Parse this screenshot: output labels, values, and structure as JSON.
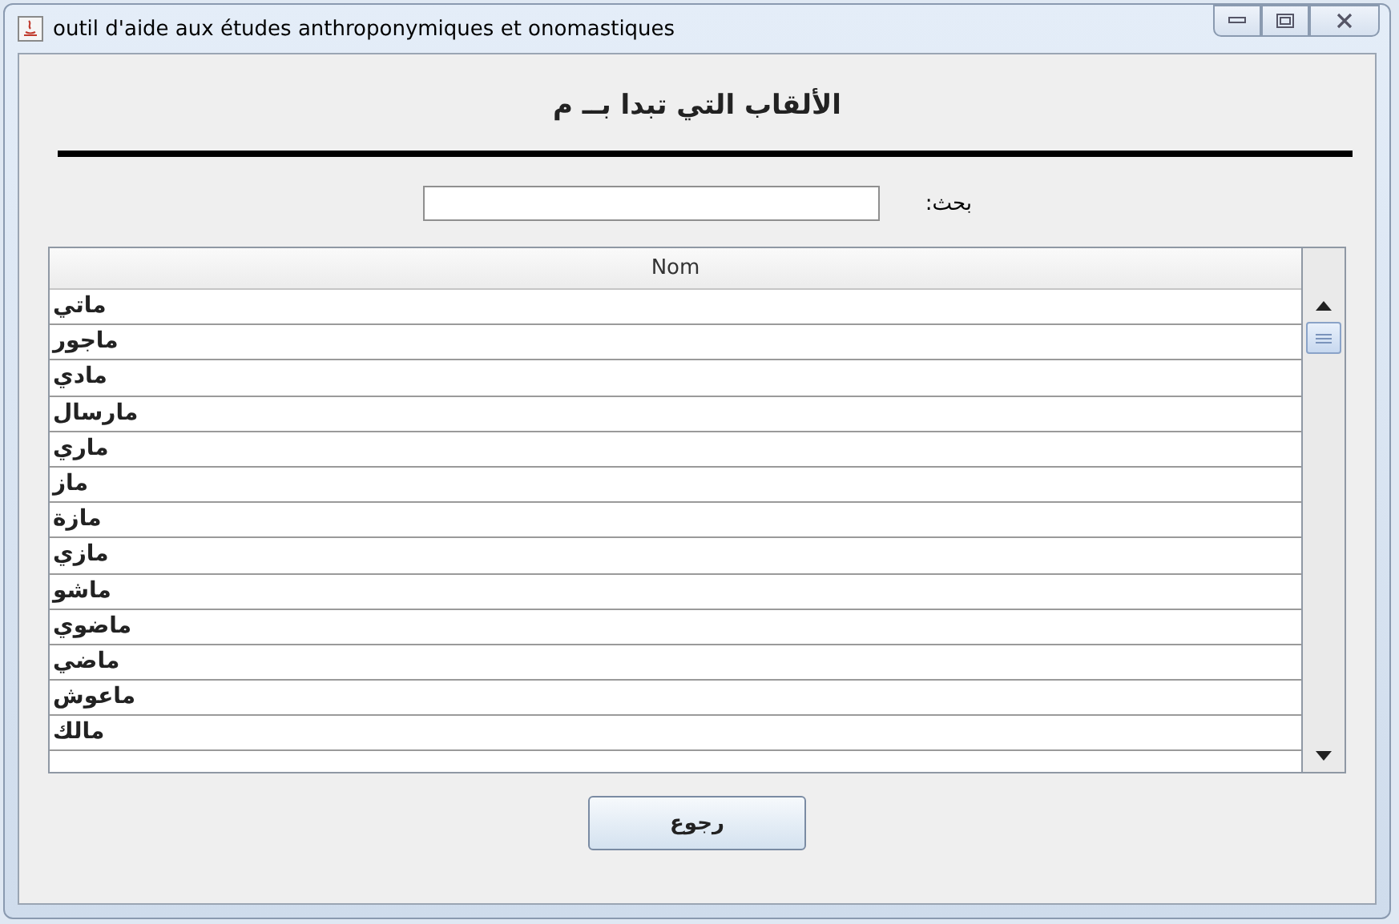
{
  "window": {
    "title": "outil d'aide aux études anthroponymiques et onomastiques"
  },
  "heading": "الألقاب التي تبدا بــ م",
  "search": {
    "label": "بحث:"
  },
  "table": {
    "columns": [
      "Nom"
    ],
    "rows": [
      "ماتي",
      "ماجور",
      "مادي",
      "مارسال",
      "ماري",
      "ماز",
      "مازة",
      "مازي",
      "ماشو",
      "ماضوي",
      "ماضي",
      "ماعوش",
      "مالك"
    ]
  },
  "buttons": [
    "رجوع"
  ]
}
